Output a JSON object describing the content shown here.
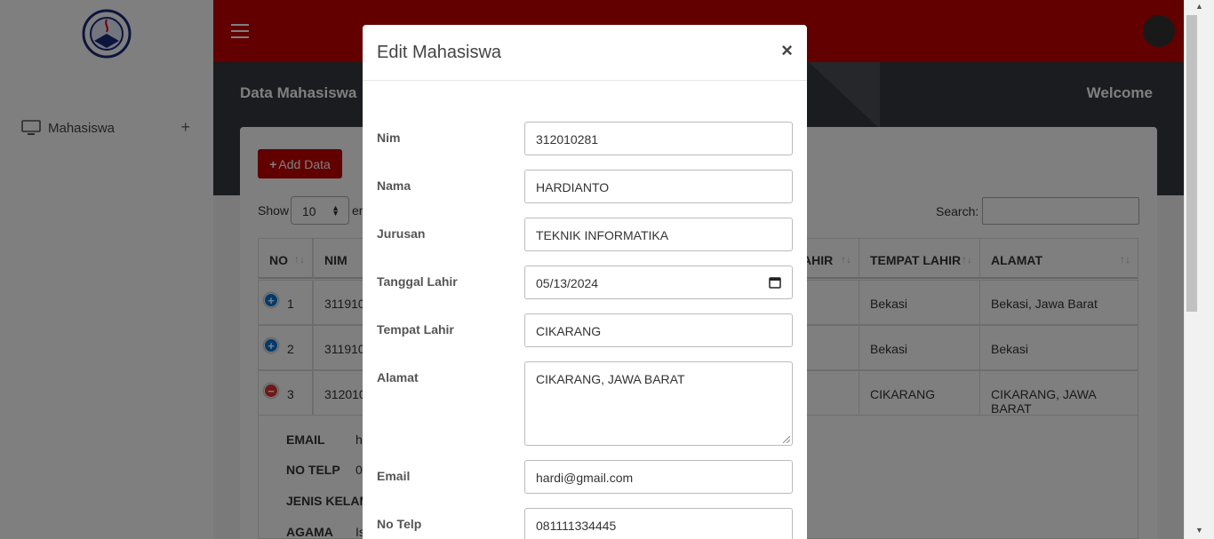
{
  "sidebar": {
    "items": [
      {
        "label": "Mahasiswa",
        "icon": "monitor-icon"
      }
    ]
  },
  "header": {
    "page_title": "Data Mahasiswa",
    "welcome": "Welcome"
  },
  "toolbar": {
    "add_label": "Add Data",
    "show_label": "Show",
    "entries_value": "10",
    "entries_suffix": "en",
    "search_label": "Search:"
  },
  "table": {
    "headers": [
      "NO",
      "NIM",
      "AHIR",
      "TEMPAT LAHIR",
      "ALAMAT"
    ],
    "rows": [
      {
        "no": "1",
        "nim": "311910",
        "tempat": "Bekasi",
        "alamat": "Bekasi, Jawa Barat",
        "expanded": false
      },
      {
        "no": "2",
        "nim": "311910",
        "tempat": "Bekasi",
        "alamat": "Bekasi",
        "expanded": false
      },
      {
        "no": "3",
        "nim": "312010",
        "tempat": "CIKARANG",
        "alamat": "CIKARANG, JAWA BARAT",
        "expanded": true
      }
    ],
    "detail": [
      {
        "label": "EMAIL",
        "value": "h"
      },
      {
        "label": "NO TELP",
        "value": "0"
      },
      {
        "label": "JENIS KELAMI",
        "value": ""
      },
      {
        "label": "AGAMA",
        "value": "Is"
      }
    ]
  },
  "modal": {
    "title": "Edit Mahasiswa",
    "close": "×",
    "fields": [
      {
        "label": "Nim",
        "value": "312010281"
      },
      {
        "label": "Nama",
        "value": "HARDIANTO"
      },
      {
        "label": "Jurusan",
        "value": "TEKNIK INFORMATIKA"
      },
      {
        "label": "Tanggal Lahir",
        "value": "05/13/2024"
      },
      {
        "label": "Tempat Lahir",
        "value": "CIKARANG"
      },
      {
        "label": "Alamat",
        "value": "CIKARANG, JAWA BARAT"
      },
      {
        "label": "Email",
        "value": "hardi@gmail.com"
      },
      {
        "label": "No Telp",
        "value": "081111334445"
      }
    ]
  },
  "colors": {
    "brand_red": "#c40000",
    "dark_band": "#34383e",
    "add_button": "#c40000"
  }
}
